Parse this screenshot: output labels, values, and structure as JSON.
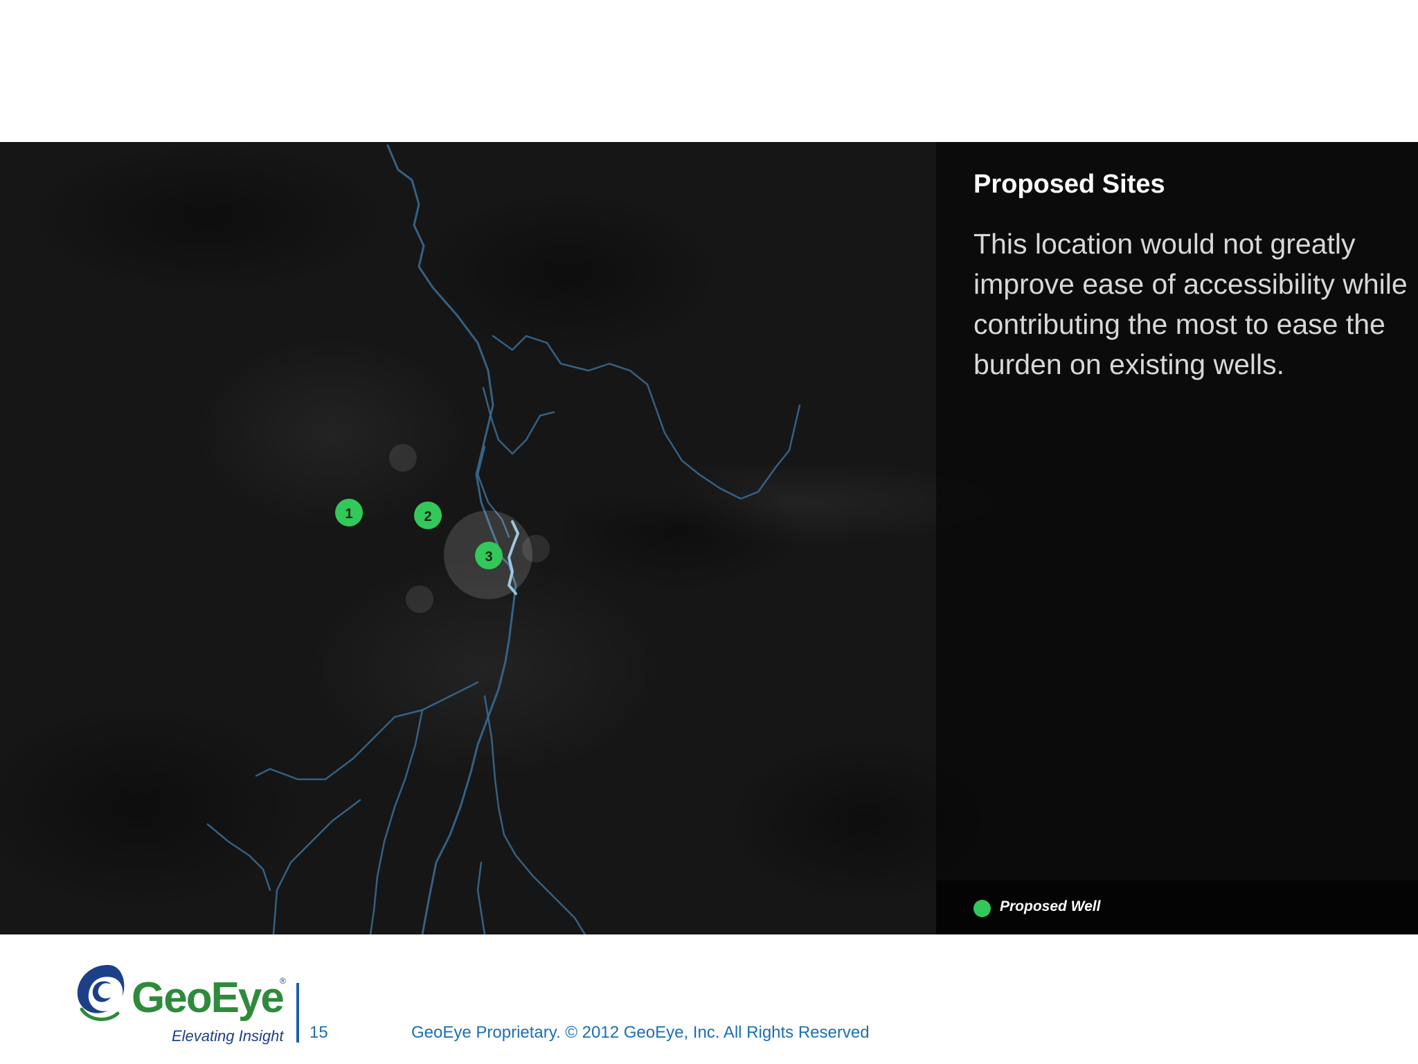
{
  "panel": {
    "title": "Proposed Sites",
    "description": "This location would not greatly improve ease of accessibility while contributing the most to ease the burden on existing wells."
  },
  "legend": {
    "label": "Proposed Well",
    "color": "#32c85a"
  },
  "wells": {
    "proposed": [
      {
        "label": "1"
      },
      {
        "label": "2"
      },
      {
        "label": "3",
        "highlighted": true
      }
    ],
    "existing_faded_count": 3
  },
  "colors": {
    "map_background": "#161616",
    "river": "#3a6f99",
    "proposed_well": "#32c85a",
    "brand_green": "#2f8a3c",
    "brand_blue": "#1c3f88",
    "footer_text": "#1b6fb5"
  },
  "footer": {
    "logo": {
      "name": "GeoEye",
      "tagline": "Elevating Insight"
    },
    "page_number": "15",
    "copyright": "GeoEye Proprietary. © 2012 GeoEye, Inc. All Rights Reserved"
  }
}
